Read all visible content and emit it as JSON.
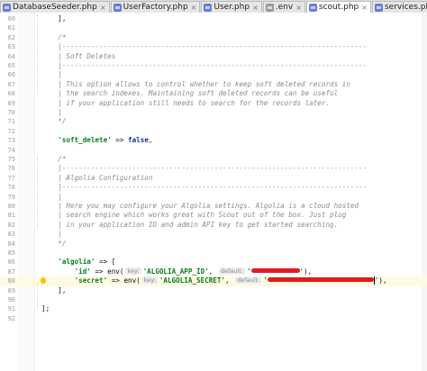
{
  "tabs": [
    {
      "label": "DatabaseSeeder.php",
      "icon": "php-class-icon",
      "active": false
    },
    {
      "label": "UserFactory.php",
      "icon": "php-class-icon",
      "active": false
    },
    {
      "label": "User.php",
      "icon": "php-class-icon",
      "active": false
    },
    {
      "label": ".env",
      "icon": "env-file-icon",
      "active": false
    },
    {
      "label": "scout.php",
      "icon": "php-file-icon",
      "active": true
    },
    {
      "label": "services.php",
      "icon": "php-file-icon",
      "active": false
    }
  ],
  "editor": {
    "lines": [
      {
        "n": "60",
        "parts": [
          {
            "t": "    ],",
            "c": "plain"
          }
        ]
      },
      {
        "n": "61",
        "parts": []
      },
      {
        "n": "62",
        "parts": [
          {
            "t": "    /*",
            "c": "comment"
          }
        ]
      },
      {
        "n": "63",
        "parts": [
          {
            "t": "    |--------------------------------------------------------------------------",
            "c": "comment"
          }
        ]
      },
      {
        "n": "64",
        "parts": [
          {
            "t": "    | Soft Deletes",
            "c": "comment"
          }
        ]
      },
      {
        "n": "65",
        "parts": [
          {
            "t": "    |--------------------------------------------------------------------------",
            "c": "comment"
          }
        ]
      },
      {
        "n": "66",
        "parts": [
          {
            "t": "    |",
            "c": "comment"
          }
        ]
      },
      {
        "n": "67",
        "parts": [
          {
            "t": "    | This option allows to control whether to keep soft deleted records in",
            "c": "comment"
          }
        ]
      },
      {
        "n": "68",
        "parts": [
          {
            "t": "    | the search indexes. Maintaining soft deleted records can be useful",
            "c": "comment"
          }
        ]
      },
      {
        "n": "69",
        "parts": [
          {
            "t": "    | if your application still needs to search for the records later.",
            "c": "comment"
          }
        ]
      },
      {
        "n": "70",
        "parts": [
          {
            "t": "    |",
            "c": "comment"
          }
        ]
      },
      {
        "n": "71",
        "parts": [
          {
            "t": "    */",
            "c": "comment"
          }
        ]
      },
      {
        "n": "72",
        "parts": []
      },
      {
        "n": "73",
        "parts": [
          {
            "t": "    ",
            "c": "plain"
          },
          {
            "t": "'soft_delete'",
            "c": "str"
          },
          {
            "t": " => ",
            "c": "plain"
          },
          {
            "t": "false",
            "c": "kw"
          },
          {
            "t": ",",
            "c": "plain"
          }
        ]
      },
      {
        "n": "74",
        "parts": []
      },
      {
        "n": "75",
        "parts": [
          {
            "t": "    /*",
            "c": "comment"
          }
        ]
      },
      {
        "n": "76",
        "parts": [
          {
            "t": "    |--------------------------------------------------------------------------",
            "c": "comment"
          }
        ]
      },
      {
        "n": "77",
        "parts": [
          {
            "t": "    | Algolia Configuration",
            "c": "comment"
          }
        ]
      },
      {
        "n": "78",
        "parts": [
          {
            "t": "    |--------------------------------------------------------------------------",
            "c": "comment"
          }
        ]
      },
      {
        "n": "79",
        "parts": [
          {
            "t": "    |",
            "c": "comment"
          }
        ]
      },
      {
        "n": "80",
        "parts": [
          {
            "t": "    | Here you may configure your Algolia settings. Algolia is a cloud hosted",
            "c": "comment"
          }
        ]
      },
      {
        "n": "81",
        "parts": [
          {
            "t": "    | search engine which works great with Scout out of the box. Just plug",
            "c": "comment"
          }
        ]
      },
      {
        "n": "82",
        "parts": [
          {
            "t": "    | in your application ID and admin API key to get started searching.",
            "c": "comment"
          }
        ]
      },
      {
        "n": "83",
        "parts": [
          {
            "t": "    |",
            "c": "comment"
          }
        ]
      },
      {
        "n": "84",
        "parts": [
          {
            "t": "    */",
            "c": "comment"
          }
        ]
      },
      {
        "n": "85",
        "parts": []
      },
      {
        "n": "86",
        "parts": [
          {
            "t": "    ",
            "c": "plain"
          },
          {
            "t": "'algolia'",
            "c": "str"
          },
          {
            "t": " => [",
            "c": "plain"
          }
        ]
      },
      {
        "n": "87",
        "parts": [
          {
            "t": "        ",
            "c": "plain"
          },
          {
            "t": "'id'",
            "c": "str"
          },
          {
            "t": " => env(",
            "c": "plain"
          },
          {
            "t": "key:",
            "c": "hint"
          },
          {
            "t": "'ALGOLIA_APP_ID'",
            "c": "str"
          },
          {
            "t": ", ",
            "c": "plain"
          },
          {
            "t": "default:",
            "c": "hint"
          },
          {
            "t": "'",
            "c": "str"
          },
          {
            "t": "54",
            "c": "redact"
          },
          {
            "t": "'),",
            "c": "plain"
          }
        ]
      },
      {
        "n": "88",
        "highlight": true,
        "bulb": true,
        "parts": [
          {
            "t": "        ",
            "c": "plain"
          },
          {
            "t": "'secret'",
            "c": "str"
          },
          {
            "t": " => env(",
            "c": "plain"
          },
          {
            "t": "key:",
            "c": "hint"
          },
          {
            "t": "'ALGOLIA_SECRET'",
            "c": "str"
          },
          {
            "t": ", ",
            "c": "plain"
          },
          {
            "t": "default:",
            "c": "hint"
          },
          {
            "t": "'",
            "c": "str"
          },
          {
            "t": "118",
            "c": "redact"
          },
          {
            "t": "caret",
            "c": "caret"
          },
          {
            "t": "'),",
            "c": "plain"
          }
        ]
      },
      {
        "n": "89",
        "parts": [
          {
            "t": "    ],",
            "c": "plain"
          }
        ]
      },
      {
        "n": "90",
        "parts": []
      },
      {
        "n": "91",
        "parts": [
          {
            "t": "];",
            "c": "plain"
          }
        ]
      },
      {
        "n": "92",
        "parts": []
      }
    ]
  }
}
